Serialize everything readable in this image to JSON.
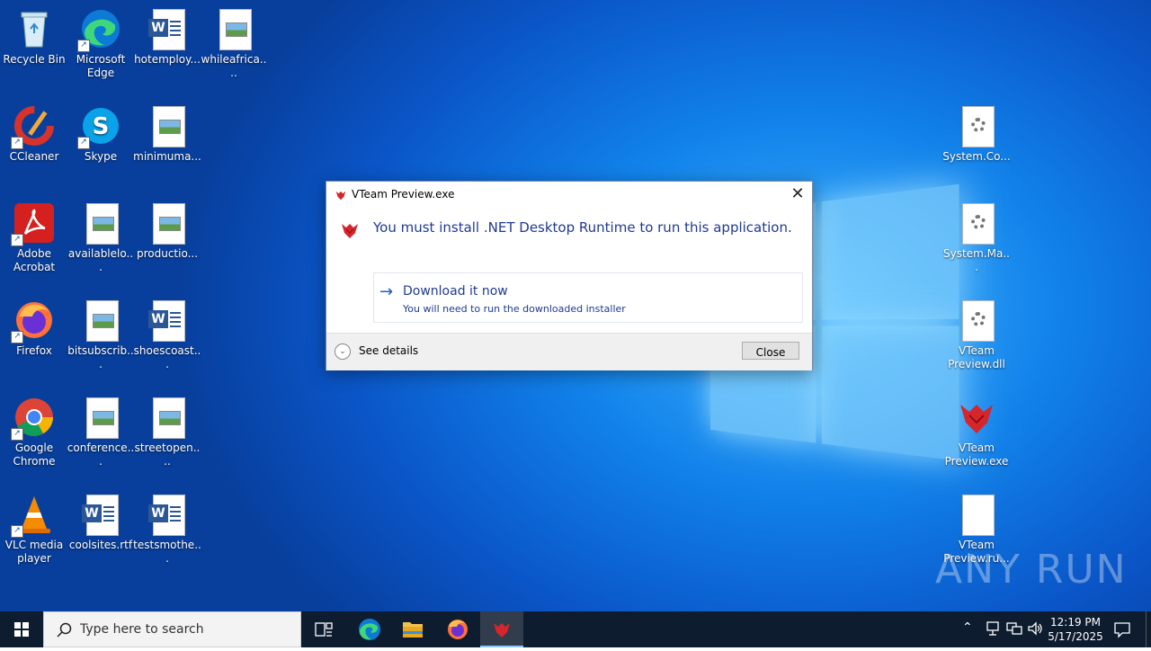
{
  "desktop": {
    "icons": [
      {
        "label": "Recycle Bin",
        "icon": "recycle-bin-icon"
      },
      {
        "label": "Microsoft Edge",
        "icon": "edge-icon"
      },
      {
        "label": "hotemploy...",
        "icon": "word-doc-icon"
      },
      {
        "label": "whileafrica....",
        "icon": "image-file-icon"
      },
      {
        "label": "CCleaner",
        "icon": "ccleaner-icon"
      },
      {
        "label": "Skype",
        "icon": "skype-icon"
      },
      {
        "label": "minimuma...",
        "icon": "image-file-icon"
      },
      {
        "label": "Adobe Acrobat",
        "icon": "acrobat-icon"
      },
      {
        "label": "availablelo...",
        "icon": "image-file-icon"
      },
      {
        "label": "productio...",
        "icon": "image-file-icon"
      },
      {
        "label": "Firefox",
        "icon": "firefox-icon"
      },
      {
        "label": "bitsubscrib...",
        "icon": "image-file-icon"
      },
      {
        "label": "shoescoast...",
        "icon": "word-doc-icon"
      },
      {
        "label": "Google Chrome",
        "icon": "chrome-icon"
      },
      {
        "label": "conference...",
        "icon": "image-file-icon"
      },
      {
        "label": "streetopen....",
        "icon": "image-file-icon"
      },
      {
        "label": "VLC media player",
        "icon": "vlc-icon"
      },
      {
        "label": "coolsites.rtf",
        "icon": "word-doc-icon"
      },
      {
        "label": "testsmothe...",
        "icon": "word-doc-icon"
      },
      {
        "label": "System.Co...",
        "icon": "gear-file-icon"
      },
      {
        "label": "System.Ma...",
        "icon": "gear-file-icon"
      },
      {
        "label": "VTeam Preview.dll",
        "icon": "gear-file-icon"
      },
      {
        "label": "VTeam Preview.exe",
        "icon": "vteam-icon"
      },
      {
        "label": "VTeam Preview.ru...",
        "icon": "blank-file-icon"
      }
    ]
  },
  "dialog": {
    "title": "VTeam Preview.exe",
    "heading": "You must install .NET Desktop Runtime to run this application.",
    "command_title": "Download it now",
    "command_subtitle": "You will need to run the downloaded installer",
    "details_label": "See details",
    "close_label": "Close"
  },
  "taskbar": {
    "search_placeholder": "Type here to search",
    "time": "12:19 PM",
    "date": "5/17/2025"
  },
  "watermark": "ANY RUN",
  "colors": {
    "desktop_blue": "#0a55c7",
    "dialog_heading": "#1f3a93",
    "taskbar": "#0d1c2e"
  }
}
